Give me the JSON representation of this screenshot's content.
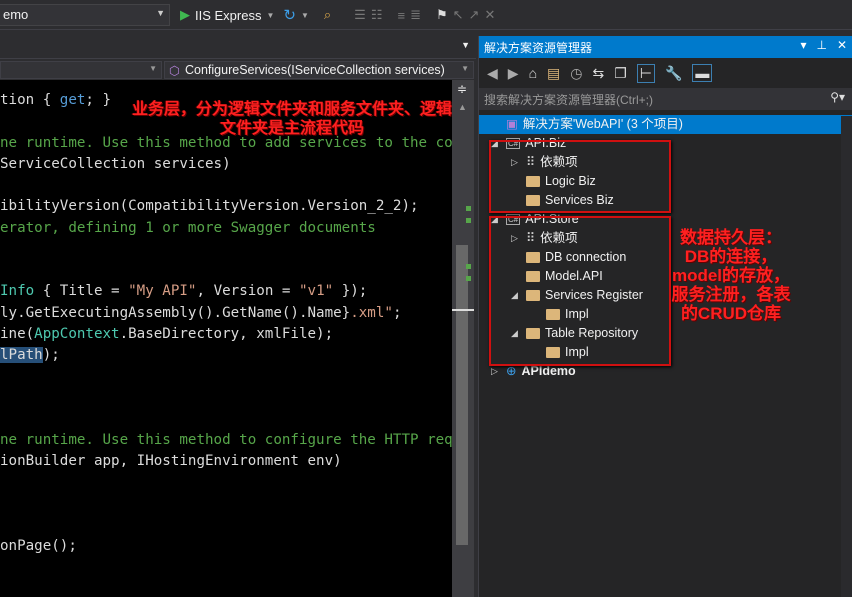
{
  "toolbar": {
    "project": "emo",
    "run_target": "IIS Express"
  },
  "navbar": {
    "member": "ConfigureServices(IServiceCollection services)"
  },
  "colors": {
    "accent": "#007acc",
    "comment": "#57a64a",
    "keyword": "#569cd6",
    "string": "#d69d85",
    "type": "#4ec9b0",
    "text": "#dcdcdc",
    "annotation": "#ff2020"
  },
  "code": [
    {
      "row": 0,
      "segs": [
        {
          "t": "tion { ",
          "c": "#dcdcdc"
        },
        {
          "t": "get",
          "c": "#569cd6"
        },
        {
          "t": "; }",
          "c": "#dcdcdc"
        }
      ]
    },
    {
      "row": 2,
      "segs": [
        {
          "t": "ne runtime. Use this method to add services to the co",
          "c": "#57a64a"
        }
      ]
    },
    {
      "row": 3,
      "segs": [
        {
          "t": "ServiceCollection services)",
          "c": "#dcdcdc"
        }
      ]
    },
    {
      "row": 5,
      "segs": [
        {
          "t": "ibilityVersion(CompatibilityVersion.Version_2_2);",
          "c": "#dcdcdc"
        }
      ]
    },
    {
      "row": 6,
      "segs": [
        {
          "t": "erator, defining 1 or more Swagger documents",
          "c": "#57a64a"
        }
      ]
    },
    {
      "row": 9,
      "segs": [
        {
          "t": "Info",
          "c": "#4ec9b0"
        },
        {
          "t": " { Title = ",
          "c": "#dcdcdc"
        },
        {
          "t": "\"My API\"",
          "c": "#d69d85"
        },
        {
          "t": ", Version = ",
          "c": "#dcdcdc"
        },
        {
          "t": "\"v1\"",
          "c": "#d69d85"
        },
        {
          "t": " });",
          "c": "#dcdcdc"
        }
      ]
    },
    {
      "row": 10,
      "segs": [
        {
          "t": "ly.GetExecutingAssembly().GetName().Name}",
          "c": "#dcdcdc"
        },
        {
          "t": ".xml\"",
          "c": "#d69d85"
        },
        {
          "t": ";",
          "c": "#dcdcdc"
        }
      ]
    },
    {
      "row": 11,
      "segs": [
        {
          "t": "ine(",
          "c": "#dcdcdc"
        },
        {
          "t": "AppContext",
          "c": "#4ec9b0"
        },
        {
          "t": ".BaseDirectory, xmlFile);",
          "c": "#dcdcdc"
        }
      ]
    },
    {
      "row": 12,
      "segs": [
        {
          "t": "lPath",
          "c": "#dcdcdc"
        },
        {
          "t": ");",
          "c": "#dcdcdc"
        }
      ]
    },
    {
      "row": 16,
      "segs": [
        {
          "t": "ne runtime. Use this method to configure the HTTP req",
          "c": "#57a64a"
        }
      ]
    },
    {
      "row": 17,
      "segs": [
        {
          "t": "ionBuilder app, IHostingEnvironment env)",
          "c": "#dcdcdc"
        }
      ]
    },
    {
      "row": 21,
      "segs": [
        {
          "t": "onPage();",
          "c": "#dcdcdc"
        }
      ]
    }
  ],
  "annotation_biz": "业务层，分为逻辑文件夹和服务文件夹、逻辑文件夹是主流程代码",
  "annotation_store": "数据持久层：DB的连接，model的存放，服务注册，各表的CRUD仓库",
  "solution_explorer": {
    "title": "解决方案资源管理器",
    "search_placeholder": "搜索解决方案资源管理器(Ctrl+;)",
    "tree": [
      {
        "label": "解决方案'WebAPI' (3 个项目)",
        "kind": "solution",
        "depth": 0,
        "expander": "",
        "selected": true
      },
      {
        "label": "API.Biz",
        "kind": "project",
        "depth": 0,
        "expander": "◢"
      },
      {
        "label": "依赖项",
        "kind": "deps",
        "depth": 1,
        "expander": "▷"
      },
      {
        "label": "Logic Biz",
        "kind": "folder",
        "depth": 1,
        "expander": ""
      },
      {
        "label": "Services Biz",
        "kind": "folder",
        "depth": 1,
        "expander": ""
      },
      {
        "label": "API.Store",
        "kind": "project",
        "depth": 0,
        "expander": "◢"
      },
      {
        "label": "依赖项",
        "kind": "deps",
        "depth": 1,
        "expander": "▷"
      },
      {
        "label": "DB connection",
        "kind": "folder",
        "depth": 1,
        "expander": ""
      },
      {
        "label": "Model.API",
        "kind": "folder",
        "depth": 1,
        "expander": ""
      },
      {
        "label": "Services Register",
        "kind": "folder",
        "depth": 1,
        "expander": "◢"
      },
      {
        "label": "Impl",
        "kind": "folder",
        "depth": 2,
        "expander": ""
      },
      {
        "label": "Table Repository",
        "kind": "folder",
        "depth": 1,
        "expander": "◢"
      },
      {
        "label": "Impl",
        "kind": "folder",
        "depth": 2,
        "expander": ""
      },
      {
        "label": "APIdemo",
        "kind": "web",
        "depth": 0,
        "expander": "▷"
      }
    ]
  }
}
